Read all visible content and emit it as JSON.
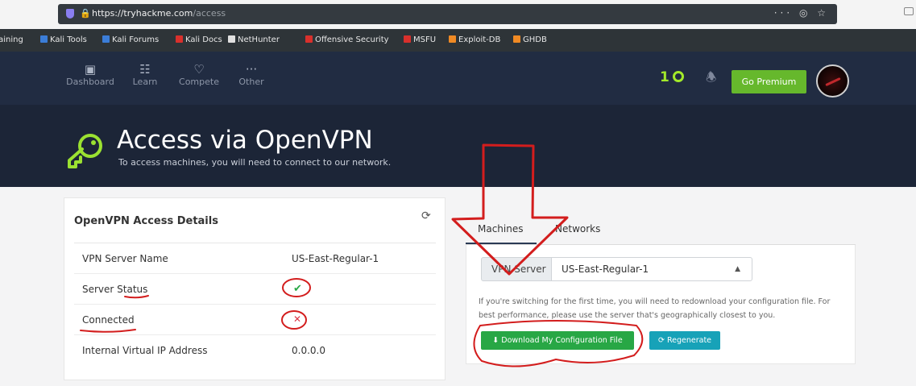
{
  "browser": {
    "url_host": "https://tryhackme.com",
    "url_path": "/access",
    "toolbar_icons": "··· ◎ ☆"
  },
  "bookmarks": [
    {
      "label": "raining",
      "color": "#cfcfcf"
    },
    {
      "label": "Kali Tools",
      "color": "#3b7dd8"
    },
    {
      "label": "Kali Forums",
      "color": "#3b7dd8"
    },
    {
      "label": "Kali Docs",
      "color": "#d9302c"
    },
    {
      "label": "NetHunter",
      "color": "#e0e0e0"
    },
    {
      "label": "Offensive Security",
      "color": "#d9302c"
    },
    {
      "label": "MSFU",
      "color": "#d9302c"
    },
    {
      "label": "Exploit-DB",
      "color": "#f08a24"
    },
    {
      "label": "GHDB",
      "color": "#f08a24"
    }
  ],
  "nav": {
    "items": [
      {
        "label": "Dashboard",
        "icon": "dashboard-icon"
      },
      {
        "label": "Learn",
        "icon": "book-icon"
      },
      {
        "label": "Compete",
        "icon": "trophy-icon"
      },
      {
        "label": "Other",
        "icon": "more-icon"
      }
    ],
    "streak": "1",
    "premium_label": "Go Premium"
  },
  "hero": {
    "title": "Access via OpenVPN",
    "subtitle": "To access machines, you will need to connect to our network."
  },
  "details": {
    "heading": "OpenVPN Access Details",
    "rows": [
      {
        "key": "VPN Server Name",
        "value": "US-East-Regular-1"
      },
      {
        "key": "Server Status",
        "value": "✔"
      },
      {
        "key": "Connected",
        "value": "✕"
      },
      {
        "key": "Internal Virtual IP Address",
        "value": "0.0.0.0"
      }
    ]
  },
  "tabs": [
    "Machines",
    "Networks"
  ],
  "vpn": {
    "label": "VPN Server",
    "selected": "US-East-Regular-1",
    "info": "If you're switching for the first time, you will need to redownload your configuration file. For best performance, please use the server that's geographically closest to you.",
    "download_label": "Download My Configuration File",
    "regenerate_label": "Regenerate"
  },
  "colors": {
    "accent_green": "#a3ea2a",
    "nav_bg": "#212c42",
    "hero_bg": "#1c2537",
    "annotation_red": "#d31d1d"
  }
}
